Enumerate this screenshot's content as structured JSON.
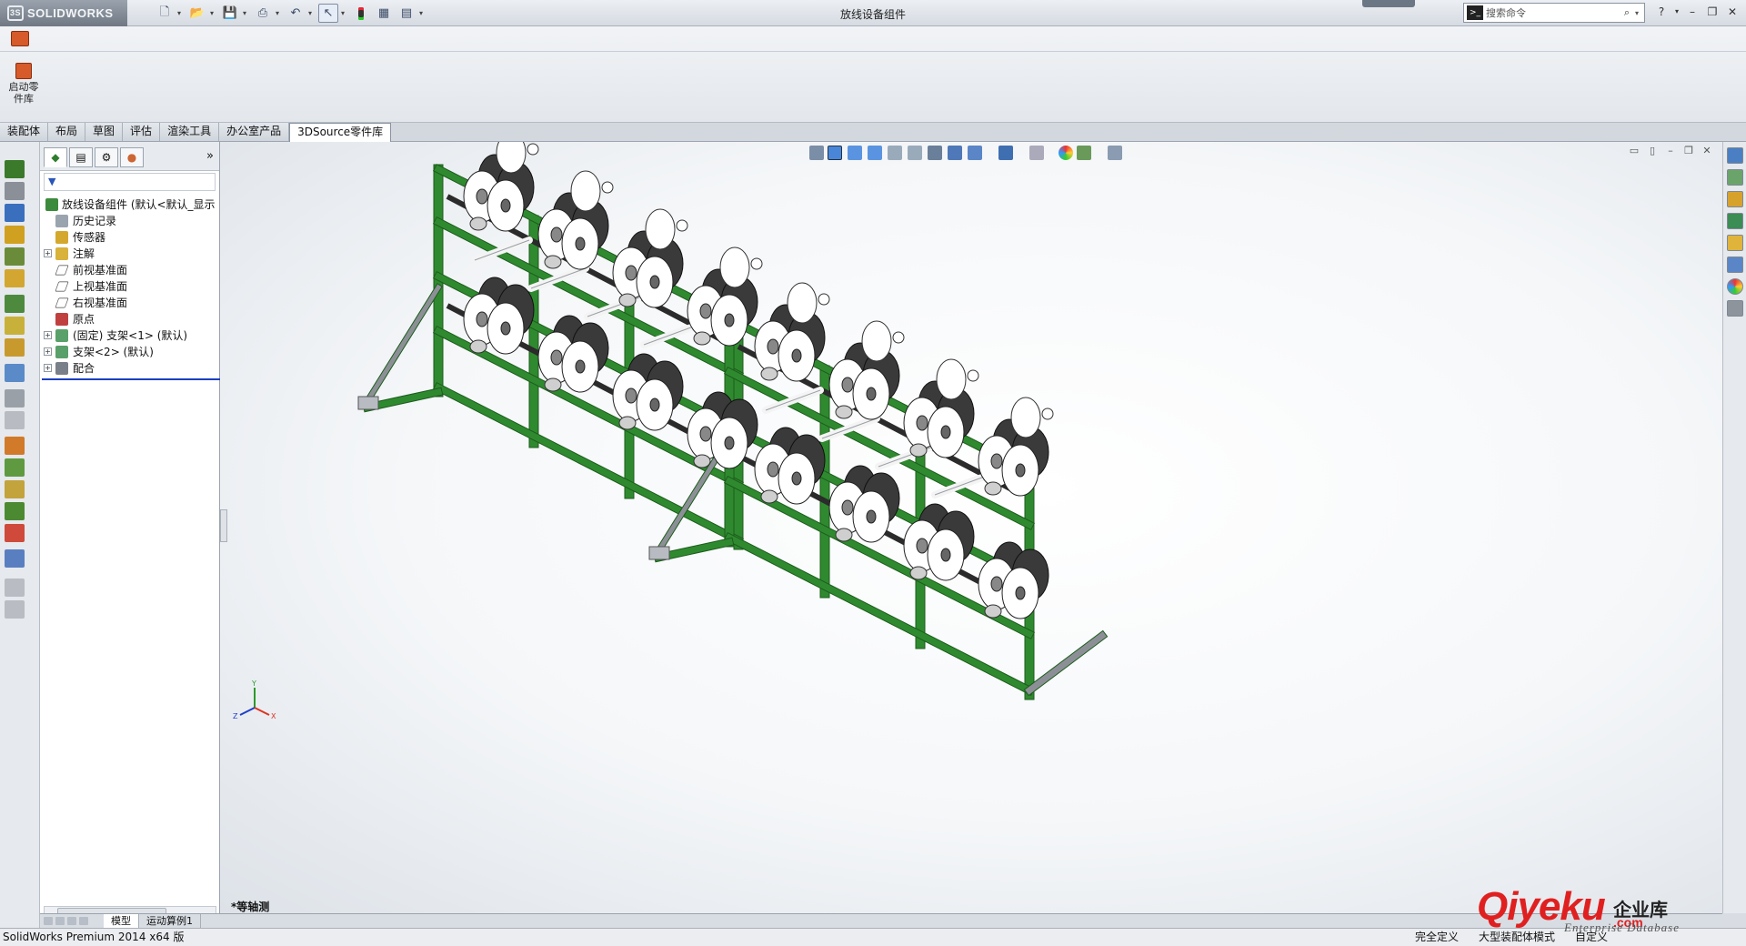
{
  "app": {
    "brand": "SOLIDWORKS",
    "brand_mark": "3S",
    "window_title": "放线设备组件"
  },
  "search": {
    "placeholder": "搜索命令",
    "cmd_glyph": ">_"
  },
  "ribbon": {
    "launch_label": "启动零件库"
  },
  "command_tabs": [
    "装配体",
    "布局",
    "草图",
    "评估",
    "渲染工具",
    "办公室产品",
    "3DSource零件库"
  ],
  "active_tab_index": 6,
  "feature_tree": {
    "root": "放线设备组件  (默认<默认_显示",
    "items": [
      {
        "label": "历史记录",
        "icon": "history-icon",
        "expand": ""
      },
      {
        "label": "传感器",
        "icon": "sensor-icon",
        "expand": ""
      },
      {
        "label": "注解",
        "icon": "annotation-icon",
        "expand": "+"
      },
      {
        "label": "前视基准面",
        "icon": "plane-icon",
        "expand": ""
      },
      {
        "label": "上视基准面",
        "icon": "plane-icon",
        "expand": ""
      },
      {
        "label": "右视基准面",
        "icon": "plane-icon",
        "expand": ""
      },
      {
        "label": "原点",
        "icon": "origin-icon",
        "expand": ""
      },
      {
        "label": "(固定) 支架<1> (默认)",
        "icon": "part-icon",
        "expand": "+"
      },
      {
        "label": "支架<2> (默认)",
        "icon": "part-icon",
        "expand": "+"
      },
      {
        "label": "配合",
        "icon": "mate-icon",
        "expand": "+"
      }
    ],
    "filter_glyph": "▼"
  },
  "viewport": {
    "view_label": "*等轴测"
  },
  "bottom_tabs": [
    "模型",
    "运动算例1"
  ],
  "status": {
    "version": "SolidWorks Premium 2014 x64 版",
    "state": "完全定义",
    "mode": "大型装配体模式",
    "custom": "自定义"
  },
  "watermark": {
    "brand": "Qiyeku",
    "cn": "企业库",
    "dom": ".com",
    "sub": "Enterprise Database"
  },
  "colors": {
    "frame_green": "#2f8a2f",
    "frame_dark": "#1d5c1d",
    "reel_dark": "#3a3a3a",
    "reel_light": "#ffffff",
    "accent_blue": "#1c3fc0"
  }
}
